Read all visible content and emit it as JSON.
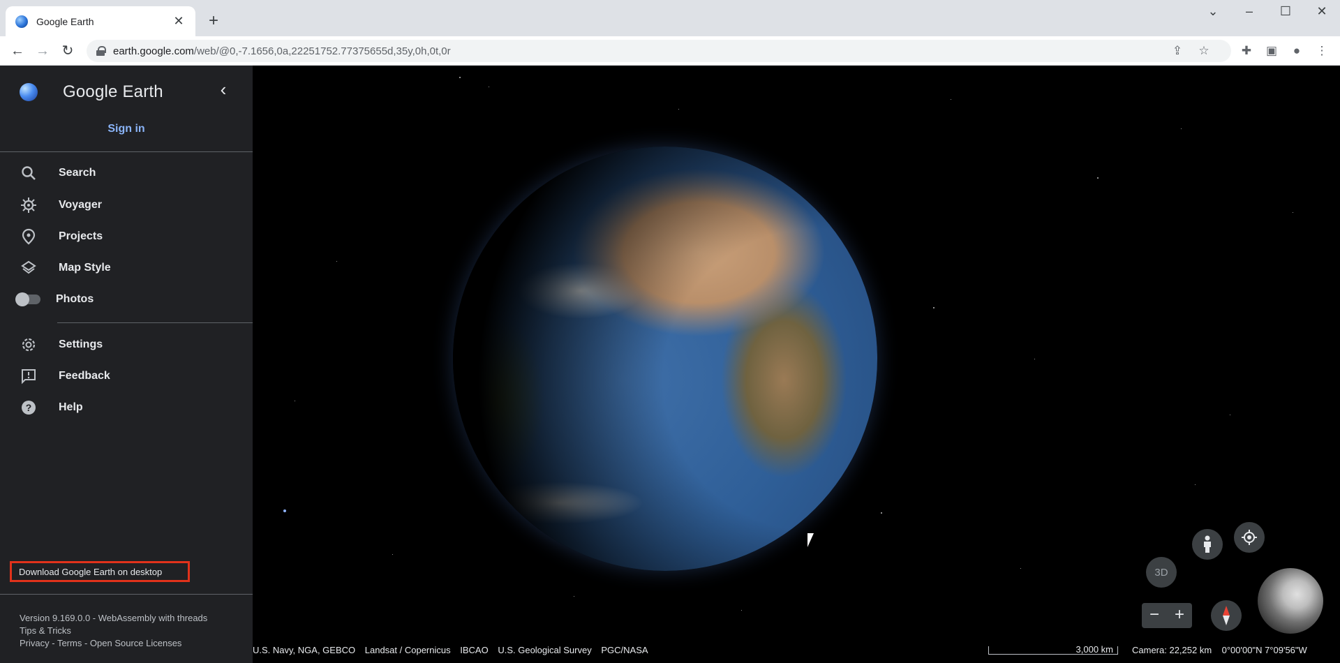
{
  "browser": {
    "tab_title": "Google Earth",
    "new_tab_symbol": "+",
    "url_host": "earth.google.com",
    "url_path": "/web/@0,-7.1656,0a,22251752.77375655d,35y,0h,0t,0r"
  },
  "sidebar": {
    "brand": "Google Earth",
    "sign_in": "Sign in",
    "items": [
      {
        "label": "Search",
        "icon": "search-icon"
      },
      {
        "label": "Voyager",
        "icon": "voyager-icon"
      },
      {
        "label": "Projects",
        "icon": "projects-icon"
      },
      {
        "label": "Map Style",
        "icon": "layers-icon"
      },
      {
        "label": "Photos",
        "icon": "toggle"
      }
    ],
    "items2": [
      {
        "label": "Settings",
        "icon": "gear-icon"
      },
      {
        "label": "Feedback",
        "icon": "feedback-icon"
      },
      {
        "label": "Help",
        "icon": "help-icon"
      }
    ],
    "download": "Download Google Earth on desktop",
    "version": "Version 9.169.0.0 - WebAssembly with threads",
    "tips": "Tips & Tricks",
    "privacy": "Privacy",
    "terms": "Terms",
    "licenses": "Open Source Licenses",
    "sep": " - "
  },
  "map": {
    "attribution": [
      "U.S. Navy, NGA, GEBCO",
      "Landsat / Copernicus",
      "IBCAO",
      "U.S. Geological Survey",
      "PGC/NASA"
    ],
    "scale": "3,000 km",
    "camera": "Camera: 22,252 km",
    "coords": "0°00'00\"N 7°09'56\"W",
    "btn_3d": "3D",
    "zoom_out": "−",
    "zoom_in": "+"
  },
  "colors": {
    "sidebar_bg": "#202124",
    "accent": "#8ab4f8",
    "highlight_border": "#e1321b"
  }
}
